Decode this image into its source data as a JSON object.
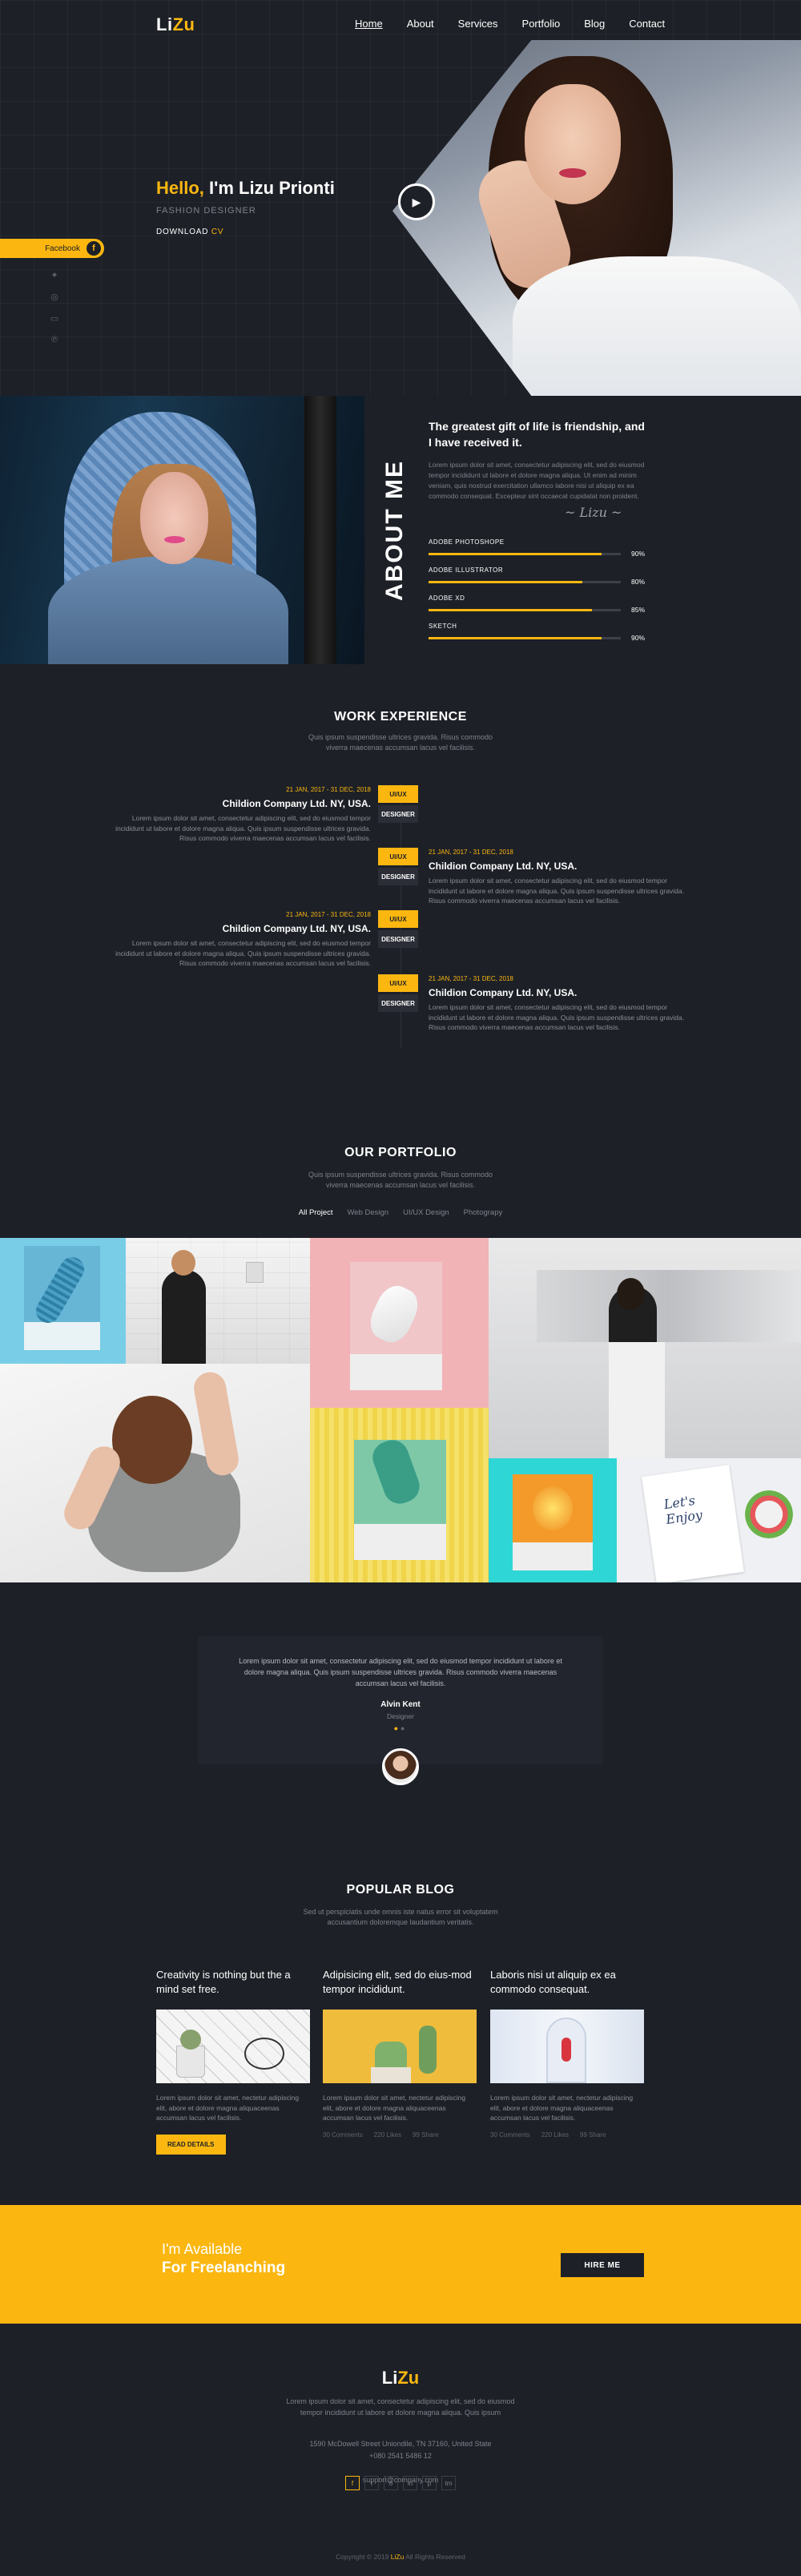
{
  "header": {
    "logo_a": "Li",
    "logo_b": "Zu",
    "nav": [
      "Home",
      "About",
      "Services",
      "Portfolio",
      "Blog",
      "Contact"
    ]
  },
  "hero": {
    "hello": "Hello,",
    "name": " I'm Lizu Prionti",
    "subtitle": "FASHION DESIGNER",
    "download_a": "DOWNLOAD",
    "download_b": " CV",
    "facebook_label": "Facebook"
  },
  "about": {
    "vertical_title": "ABOUT ME",
    "heading": "The greatest gift of life is friendship, and I have received it.",
    "body": "Lorem ipsum dolor sit amet, consectetur adipiscing elit, sed do eiusmod tempor incididunt ut labore et dolore magna aliqua. Ut enim ad minim veniam, quis nostrud exercitation ullamco labore nisi ut aliquip ex ea commodo consequat. Excepteur sint occaecat cupidatat non proident.",
    "skills": [
      {
        "name": "ADOBE PHOTOSHOPE",
        "percent": "90%",
        "value": 0.9
      },
      {
        "name": "ADOBE ILLUSTRATOR",
        "percent": "80%",
        "value": 0.8
      },
      {
        "name": "ADOBE XD",
        "percent": "85%",
        "value": 0.85
      },
      {
        "name": "SKETCH",
        "percent": "90%",
        "value": 0.9
      }
    ]
  },
  "work": {
    "title": "WORK EXPERIENCE",
    "sub_1": "Quis ipsum suspendisse ultrices gravida. Risus commodo",
    "sub_2": "viverra maecenas accumsan lacus vel facilisis.",
    "entries": [
      {
        "date": "21 JAN, 2017 - 31 DEC, 2018",
        "company": "Childion Company Ltd. NY, USA.",
        "text": "Lorem ipsum dolor sit amet, consectetur adipiscing elit, sed do eiusmod tempor incididunt ut labore et dolore magna aliqua. Quis ipsum suspendisse ultrices gravida. Risus commodo viverra maecenas accumsan lacus vel facilisis.",
        "tag1": "UI/UX",
        "tag2": "DESIGNER"
      },
      {
        "date": "21 JAN, 2017 - 31 DEC, 2018",
        "company": "Childion Company Ltd. NY, USA.",
        "text": "Lorem ipsum dolor sit amet, consectetur adipiscing elit, sed do eiusmod tempor incididunt ut labore et dolore magna aliqua. Quis ipsum suspendisse ultrices gravida. Risus commodo viverra maecenas accumsan lacus vel facilisis.",
        "tag1": "UI/UX",
        "tag2": "DESIGNER"
      },
      {
        "date": "21 JAN, 2017 - 31 DEC, 2018",
        "company": "Childion Company Ltd. NY, USA.",
        "text": "Lorem ipsum dolor sit amet, consectetur adipiscing elit, sed do eiusmod tempor incididunt ut labore et dolore magna aliqua. Quis ipsum suspendisse ultrices gravida. Risus commodo viverra maecenas accumsan lacus vel facilisis.",
        "tag1": "UI/UX",
        "tag2": "DESIGNER"
      },
      {
        "date": "21 JAN, 2017 - 31 DEC, 2018",
        "company": "Childion Company Ltd. NY, USA.",
        "text": "Lorem ipsum dolor sit amet, consectetur adipiscing elit, sed do eiusmod tempor incididunt ut labore et dolore magna aliqua. Quis ipsum suspendisse ultrices gravida. Risus commodo viverra maecenas accumsan lacus vel facilisis.",
        "tag1": "UI/UX",
        "tag2": "DESIGNER"
      }
    ]
  },
  "portfolio": {
    "title": "OUR PORTFOLIO",
    "sub_1": "Quis ipsum suspendisse ultrices gravida. Risus commodo",
    "sub_2": "viverra maecenas accumsan lacus vel facilisis.",
    "filters": [
      "All Project",
      "Web Design",
      "UI/UX Design",
      "Photograpy"
    ]
  },
  "testimonial": {
    "text": "Lorem ipsum dolor sit amet, consectetur adipiscing elit, sed do eiusmod tempor incididunt ut labore et dolore magna aliqua. Quis ipsum suspendisse ultrices gravida. Risus commodo viverra maecenas accumsan lacus vel facilisis.",
    "name": "Alvin Kent",
    "role": "Designer"
  },
  "blog": {
    "title": "POPULAR BLOG",
    "sub_1": "Sed ut perspiciatis unde omnis iste natus error sit voluptatem",
    "sub_2": "accusantium doloremque laudantium veritatis.",
    "posts": [
      {
        "title": "Creativity is nothing but the a mind set free.",
        "text": "Lorem ipsum dolor sit amet, nectetur adipiscing elit, abore et dolore magna aliquaceenas accumsan lacus vel facilisis.",
        "button": "READ DETAILS"
      },
      {
        "title": "Adipisicing elit, sed do eius-mod tempor incididunt.",
        "text": "Lorem ipsum dolor sit amet, nectetur adipiscing elit, abore et dolore magna aliquaceenas accumsan lacus vel facilisis.",
        "comments": "30 Comments",
        "likes": "220 Likes",
        "shares": "99 Share"
      },
      {
        "title": "Laboris nisi ut aliquip ex ea commodo consequat.",
        "text": "Lorem ipsum dolor sit amet, nectetur adipiscing elit, abore et dolore magna aliquaceenas accumsan lacus vel facilisis.",
        "comments": "30 Comments",
        "likes": "220 Likes",
        "shares": "99 Share"
      }
    ]
  },
  "cta": {
    "line1": "I'm Available",
    "line2": "For Freelanching",
    "button": "HIRE ME"
  },
  "footer": {
    "logo_a": "Li",
    "logo_b": "Zu",
    "desc_1": "Lorem ipsum dolor sit amet, consectetur adipiscing elit, sed do eiusmod",
    "desc_2": "tempor incididunt ut labore et dolore magna aliqua. Quis ipsum",
    "address": "1590 McDowell Street Uniondile, TN 37160, United State",
    "phone": "+080 2541 5486 12",
    "email": "support@company.com",
    "social_icons": [
      "f",
      "t",
      "o",
      "in",
      "p",
      "tm"
    ],
    "copy_a": "Copyright © 2019 ",
    "copy_brand": "LiZu",
    "copy_b": " All Rights Reserved"
  },
  "colors": {
    "accent": "#fbb710",
    "background": "#1d2027"
  }
}
